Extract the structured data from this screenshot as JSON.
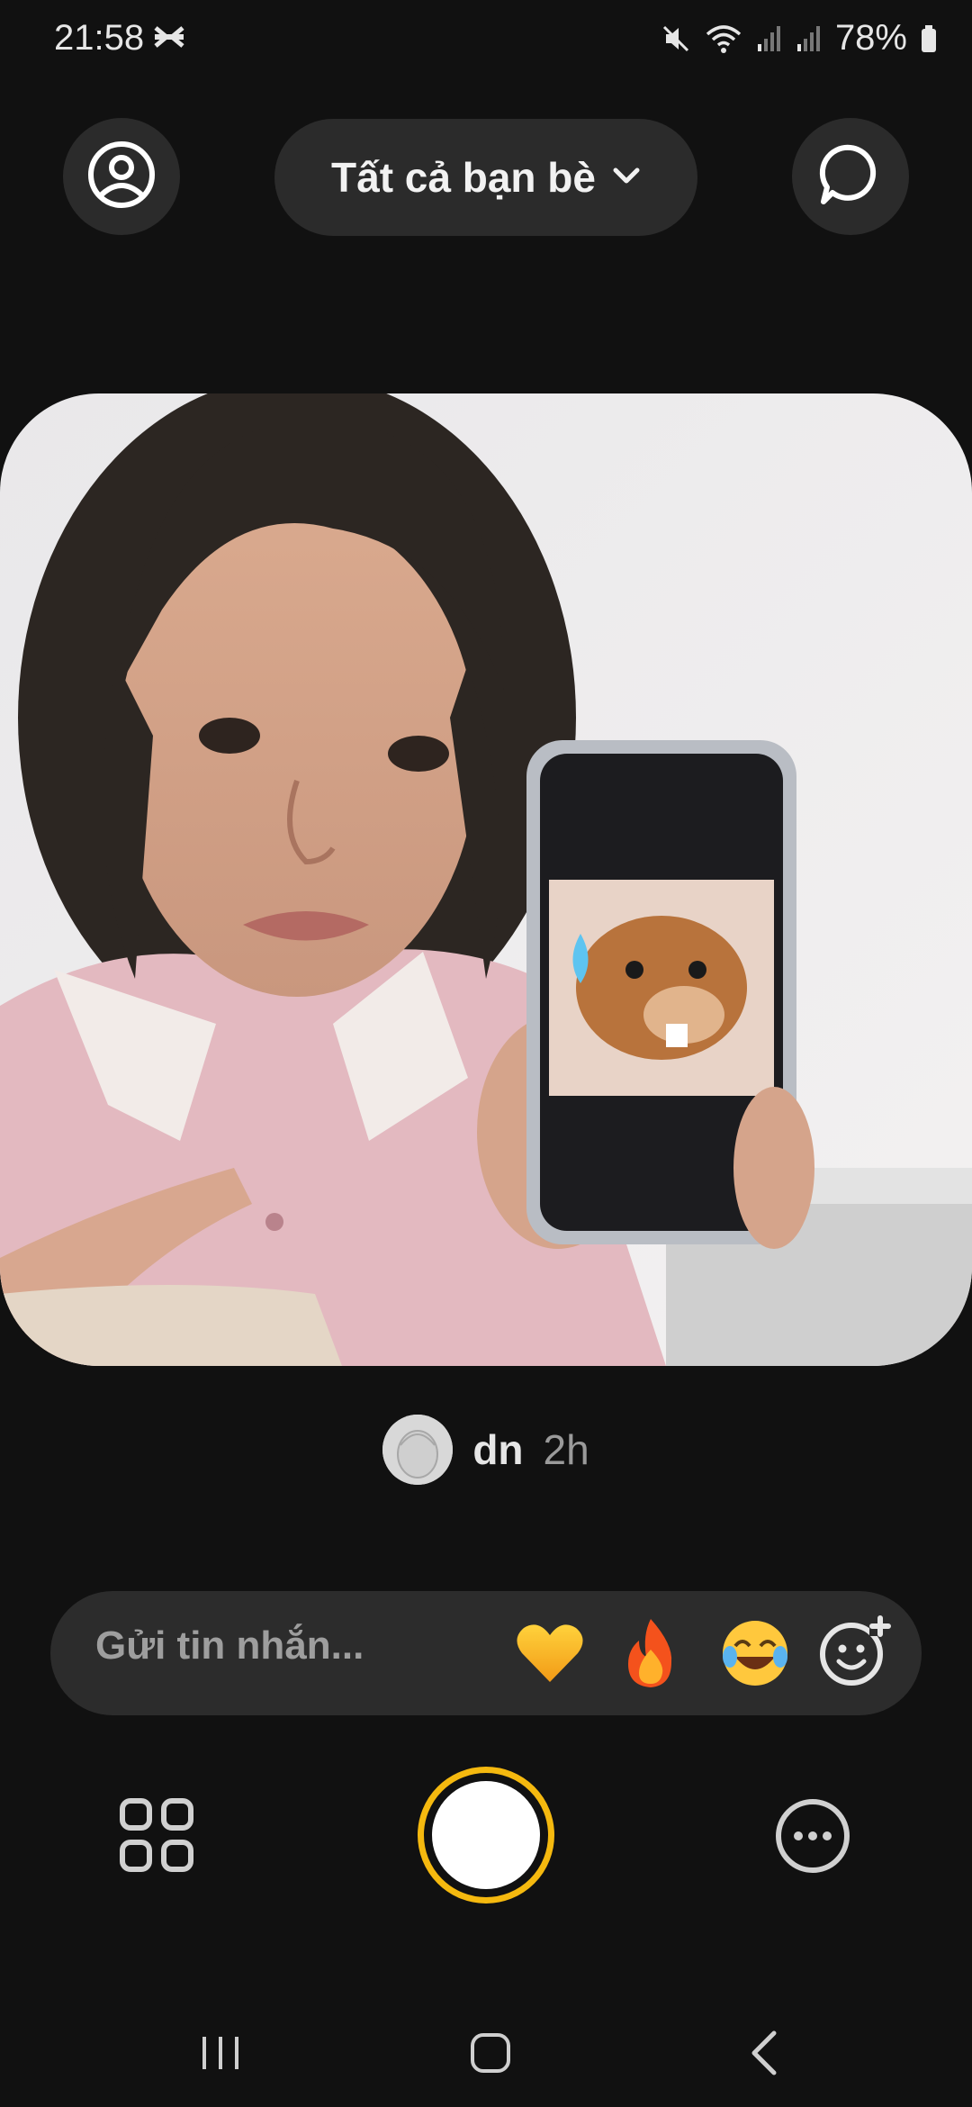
{
  "status_bar": {
    "time": "21:58",
    "battery": "78%",
    "icons": [
      "capcut-icon",
      "mute-icon",
      "wifi-icon",
      "signal-icon",
      "signal-icon",
      "battery-icon"
    ]
  },
  "header": {
    "friends_filter_label": "Tất cả bạn bè",
    "profile_icon": "profile-icon",
    "chat_icon": "chat-icon"
  },
  "post": {
    "author_name": "dn",
    "time_ago": "2h"
  },
  "message_bar": {
    "placeholder": "Gửi tin nhắn...",
    "reactions": [
      "💛",
      "🔥",
      "😂"
    ],
    "add_reaction_icon": "add-emoji-icon"
  },
  "controls": {
    "grid_icon": "grid-icon",
    "shutter_color": "#f5b90f",
    "more_icon": "more-icon"
  },
  "colors": {
    "background": "#111111",
    "surface": "#2b2b2b",
    "accent": "#f5b90f"
  }
}
